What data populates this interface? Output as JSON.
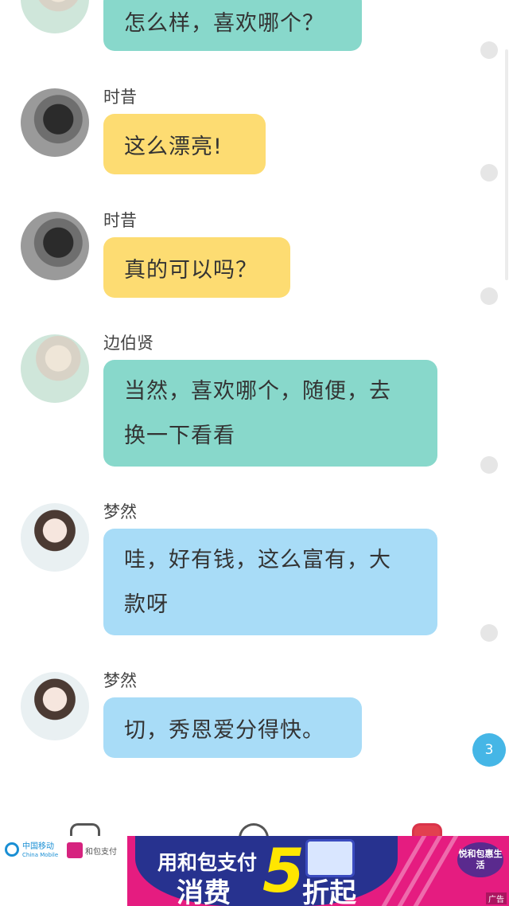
{
  "messages": [
    {
      "name": "",
      "text": "怎么样，喜欢哪个？",
      "color": "#88d8cb",
      "avatar": "boy-light"
    },
    {
      "name": "时昔",
      "text": "这么漂亮!",
      "color": "#fddc72",
      "avatar": "girl-dark"
    },
    {
      "name": "时昔",
      "text": "真的可以吗？",
      "color": "#fddc72",
      "avatar": "girl-dark"
    },
    {
      "name": "边伯贤",
      "text_lines": [
        "当然，喜欢哪个，随便，去",
        "换一下看看"
      ],
      "color": "#88d8cb",
      "avatar": "boy-light"
    },
    {
      "name": "梦然",
      "text_lines": [
        "哇，好有钱，这么富有，大",
        "款呀"
      ],
      "color": "#a8dcf7",
      "avatar": "girl-light"
    },
    {
      "name": "梦然",
      "text": "切，秀恩爱分得快。",
      "color": "#a8dcf7",
      "avatar": "girl-light"
    }
  ],
  "unread_badge": {
    "count": "3",
    "color": "#45b6e6"
  },
  "ad": {
    "china_mobile": "中国移动",
    "china_mobile_en": "China Mobile",
    "hebao": "和包支付",
    "line1": "用和包支付",
    "line2": "消费",
    "five": "5",
    "zhe": "折起",
    "badge": "悦和包惠生活",
    "label": "广告"
  }
}
